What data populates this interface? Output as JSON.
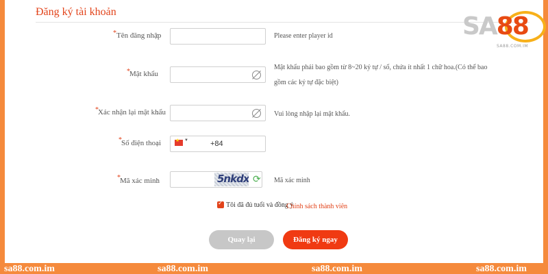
{
  "form": {
    "title": "Đăng ký tài khoản",
    "username": {
      "label": "Tên đăng nhập",
      "value": "",
      "hint": "Please enter player id"
    },
    "password": {
      "label": "Mật khẩu",
      "value": "",
      "hint": "Mật khẩu phải bao gồm từ 8~20 ký tự / số, chứa ít nhất 1 chữ hoa.(Có thể bao gồm các ký tự đặc biệt)"
    },
    "confirm_password": {
      "label": "Xác nhận lại mật khẩu",
      "value": "",
      "hint": "Vui lòng nhập lại mật khẩu."
    },
    "phone": {
      "label": "Số điện thoại",
      "country_code": "+84",
      "value": ""
    },
    "captcha": {
      "label": "Mã xác minh",
      "value": "",
      "image_text": "5nkdx",
      "hint": "Mã xác minh"
    },
    "colon": ":",
    "required_mark": "*",
    "agree_text": "Tôi đã đủ tuổi và đồng ý",
    "agree_link": "Chính sách thành viên",
    "agree_checked": true,
    "back_button": "Quay lại",
    "register_button": "Đăng ký ngay"
  },
  "logo": {
    "text_main": "SA",
    "text_num": "88",
    "sub": "SA88.COM.IM"
  },
  "watermark": "sa88.com.im",
  "colors": {
    "accent": "#e2431a",
    "frame": "#f58a3c",
    "button_primary": "#f03a12",
    "button_secondary": "#c7c7c7"
  },
  "icons": {
    "password_toggle": "eye-off-icon",
    "refresh": "refresh-icon",
    "flag": "vietnam-flag-icon"
  }
}
